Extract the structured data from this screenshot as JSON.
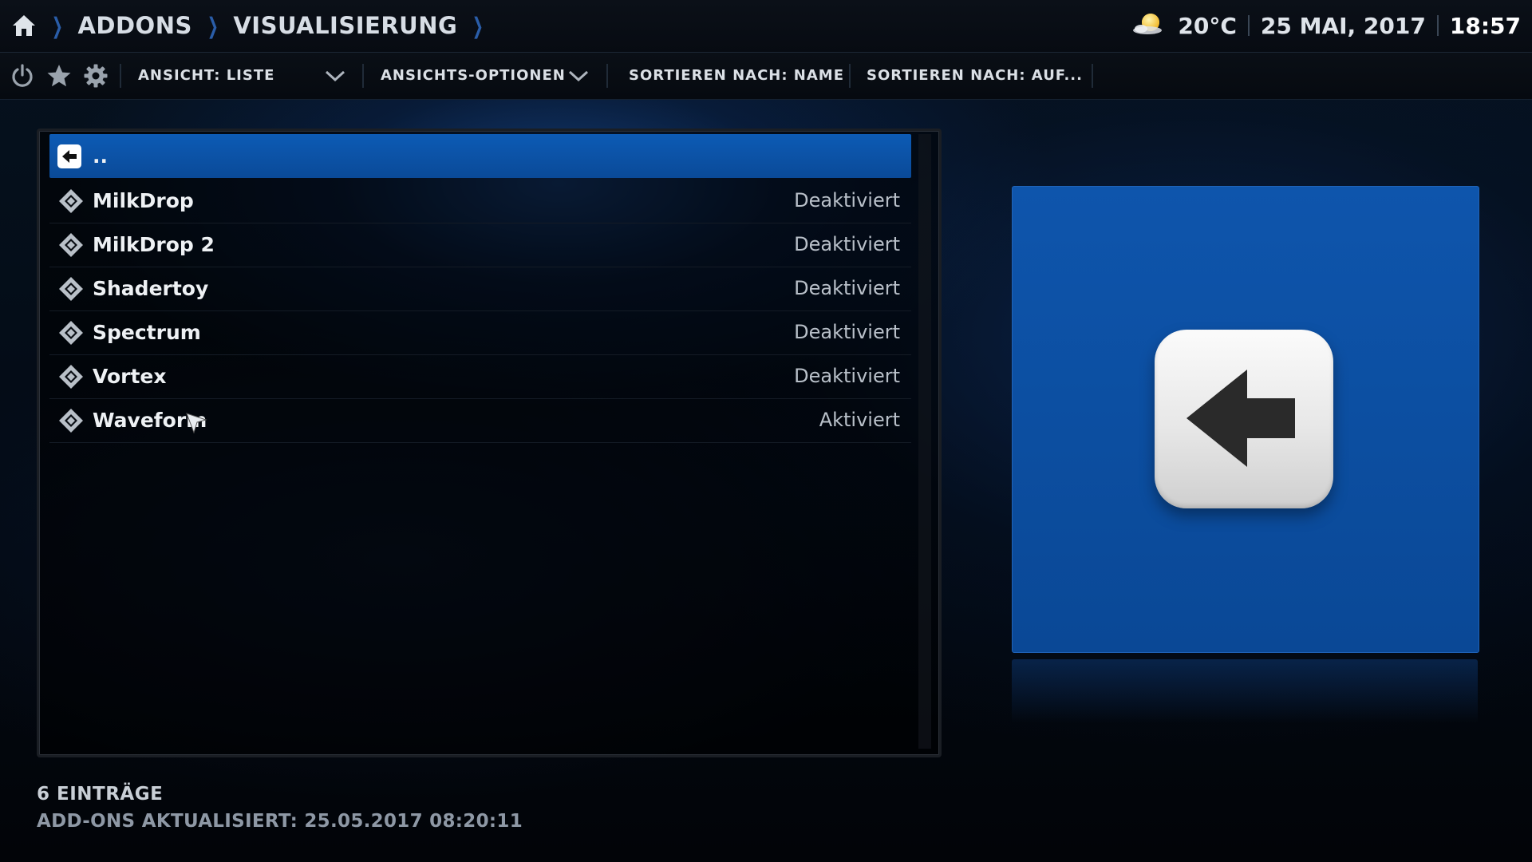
{
  "breadcrumb": {
    "home_icon": "home-icon",
    "items": [
      "ADDONS",
      "VISUALISIERUNG"
    ]
  },
  "status": {
    "weather_icon": "partly-sunny-icon",
    "temperature": "20°C",
    "date": "25 MAI, 2017",
    "time": "18:57"
  },
  "toolbar": {
    "icons": [
      "power-icon",
      "star-icon",
      "gear-icon"
    ],
    "view_label": "ANSICHT: LISTE",
    "view_options_label": "ANSICHTS-OPTIONEN",
    "sort_by_label": "SORTIEREN NACH: NAME",
    "sort_order_label": "SORTIEREN NACH: AUF..."
  },
  "list": {
    "items": [
      {
        "name": "..",
        "state": "",
        "icon": "back-arrow-icon",
        "selected": true
      },
      {
        "name": "MilkDrop",
        "state": "Deaktiviert",
        "icon": "addon-icon"
      },
      {
        "name": "MilkDrop 2",
        "state": "Deaktiviert",
        "icon": "addon-icon"
      },
      {
        "name": "Shadertoy",
        "state": "Deaktiviert",
        "icon": "addon-icon"
      },
      {
        "name": "Spectrum",
        "state": "Deaktiviert",
        "icon": "addon-icon"
      },
      {
        "name": "Vortex",
        "state": "Deaktiviert",
        "icon": "addon-icon"
      },
      {
        "name": "Waveform",
        "state": "Aktiviert",
        "icon": "addon-icon"
      }
    ]
  },
  "preview": {
    "icon": "back-arrow-icon"
  },
  "footer": {
    "count": "6 EINTRÄGE",
    "updated": "ADD-ONS AKTUALISIERT: 25.05.2017 08:20:11"
  },
  "colors": {
    "accent": "#0d5bb5",
    "breadcrumb_chevron": "#2a5da8",
    "background": "#030a14"
  }
}
